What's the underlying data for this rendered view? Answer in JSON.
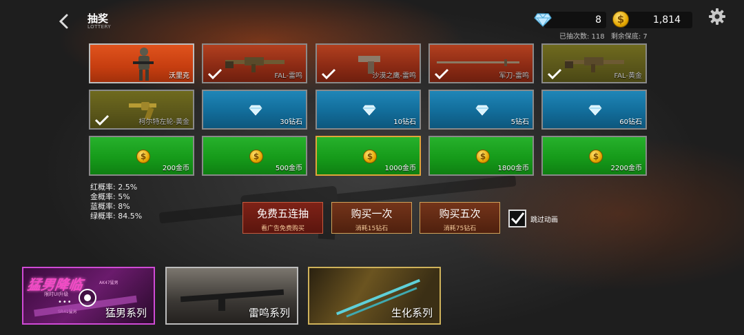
{
  "header": {
    "title": "抽奖",
    "subtitle": "LOTTERY"
  },
  "currency": {
    "diamonds": "8",
    "coins": "1,814"
  },
  "stats": {
    "draw_count": "已抽次数: 118",
    "pity_left": "剩余保底: 7"
  },
  "rewards": [
    {
      "label": "沃里克",
      "tier": "red",
      "kind": "character",
      "owned": false
    },
    {
      "label": "FAL-雷鸣",
      "tier": "red",
      "kind": "rifle",
      "owned": true
    },
    {
      "label": "沙漠之鹰-雷鸣",
      "tier": "red",
      "kind": "pistol",
      "owned": true
    },
    {
      "label": "军刀-雷鸣",
      "tier": "red",
      "kind": "sword",
      "owned": true
    },
    {
      "label": "FAL-黄金",
      "tier": "gold",
      "kind": "rifle",
      "owned": true
    },
    {
      "label": "柯尔特左轮-黄金",
      "tier": "gold",
      "kind": "revolver",
      "owned": true
    },
    {
      "label": "30钻石",
      "tier": "blue",
      "kind": "diamond",
      "owned": false
    },
    {
      "label": "10钻石",
      "tier": "blue",
      "kind": "diamond",
      "owned": false
    },
    {
      "label": "5钻石",
      "tier": "blue",
      "kind": "diamond",
      "owned": false
    },
    {
      "label": "60钻石",
      "tier": "blue",
      "kind": "diamond",
      "owned": false
    },
    {
      "label": "200金币",
      "tier": "green",
      "kind": "coin",
      "owned": false
    },
    {
      "label": "500金币",
      "tier": "green",
      "kind": "coin",
      "owned": false
    },
    {
      "label": "1000金币",
      "tier": "green",
      "kind": "coin",
      "owned": false,
      "highlighted": true
    },
    {
      "label": "1800金币",
      "tier": "green",
      "kind": "coin",
      "owned": false
    },
    {
      "label": "2200金币",
      "tier": "green",
      "kind": "coin",
      "owned": false
    }
  ],
  "odds": [
    {
      "label": "红概率:",
      "value": "2.5%"
    },
    {
      "label": "金概率:",
      "value": "5%"
    },
    {
      "label": "蓝概率:",
      "value": "8%"
    },
    {
      "label": "绿概率:",
      "value": "84.5%"
    }
  ],
  "actions": [
    {
      "title": "免费五连抽",
      "subtitle": "看广告免费购买"
    },
    {
      "title": "购买一次",
      "subtitle": "消耗15钻石"
    },
    {
      "title": "购买五次",
      "subtitle": "消耗75钻石"
    }
  ],
  "skip_animation": {
    "label": "跳过动画",
    "checked": true
  },
  "series": [
    {
      "name": "猛男系列",
      "banner_title": "猛男降临",
      "banner_sub1": "AK47猛男",
      "banner_sub2": "限时UI升级",
      "banner_sub3": "SR41猛男",
      "pager": "•••"
    },
    {
      "name": "雷鸣系列"
    },
    {
      "name": "生化系列"
    }
  ],
  "colors": {
    "red": "#b2401f",
    "gold": "#6f6a1e",
    "blue": "#1f86b7",
    "green": "#27b12c",
    "accent": "#e2a63a"
  }
}
